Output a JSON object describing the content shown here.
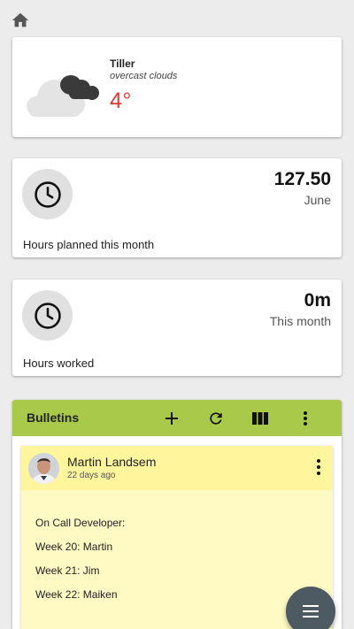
{
  "nav": {
    "home_icon": "home-icon"
  },
  "weather": {
    "city": "Tiller",
    "condition": "overcast clouds",
    "temperature": "4°",
    "icon": "cloud-icon",
    "temp_color": "#e53935"
  },
  "hours_planned": {
    "value": "127.50",
    "period": "June",
    "label": "Hours planned this month",
    "icon": "clock-icon"
  },
  "hours_worked": {
    "value": "0m",
    "period": "This month",
    "label": "Hours worked",
    "icon": "clock-icon"
  },
  "bulletins": {
    "title": "Bulletins",
    "header_color": "#a8c94a",
    "actions": [
      "add-icon",
      "refresh-icon",
      "columns-icon",
      "more-vert-icon"
    ],
    "items": [
      {
        "author": "Martin Landsem",
        "posted": "22 days ago",
        "lines": [
          "On Call Developer:",
          "Week 20: Martin",
          "Week 21: Jim",
          "Week 22: Maiken"
        ]
      }
    ]
  },
  "fab": {
    "icon": "menu-icon",
    "color": "#4e5a62"
  }
}
